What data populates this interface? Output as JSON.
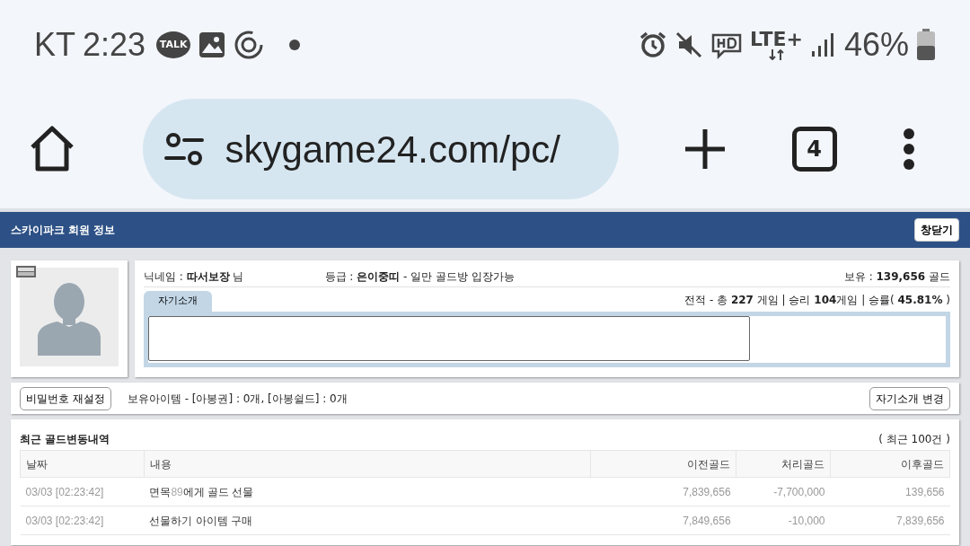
{
  "status_bar": {
    "carrier": "KT",
    "time": "2:23",
    "talk_label": "TALK",
    "network": "LTE+",
    "battery": "46%"
  },
  "browser": {
    "url": "skygame24.com/pc/",
    "tab_count": "4"
  },
  "page": {
    "title": "스카이파크 회원 정보",
    "close_button": "창닫기"
  },
  "profile": {
    "nickname": "닉네임 : **따서보장** 님",
    "grade": "등급 : **은이중띠** - 일만 골드방 입장가능",
    "gold": "보유 : **139,656** 골드",
    "record": "전적 - 총 **227** 게임 | 승리 **104**게임 | 승률( **45.81%** )",
    "tabs": [
      {
        "label": "자기소개",
        "selected": true
      }
    ]
  },
  "items_bar": {
    "reset_button": "비밀번호 재설정",
    "items": "보유아이템 - [아봉권] : 0개, [아봉쉴드] : 0개",
    "edit_button": "자기소개 변경"
  },
  "history": {
    "title": "최근 골드변동내역",
    "count": "( 최근 100건 )",
    "columns": [
      "날짜",
      "내용",
      "이전골드",
      "처리골드",
      "이후골드"
    ],
    "rows": [
      {
        "date": "03/03 [02:23:42]",
        "content": [
          {
            "text": "면목",
            "muted": false
          },
          {
            "text": "89",
            "muted": true
          },
          {
            "text": "에게 골드 선물",
            "muted": false
          }
        ],
        "before": "7,839,656",
        "change": "-7,700,000",
        "after": "139,656"
      },
      {
        "date": "03/03 [02:23:42]",
        "content": [
          {
            "text": "선물하기 아이템 구매",
            "muted": false
          }
        ],
        "before": "7,849,656",
        "change": "-10,000",
        "after": "7,839,656"
      }
    ]
  }
}
